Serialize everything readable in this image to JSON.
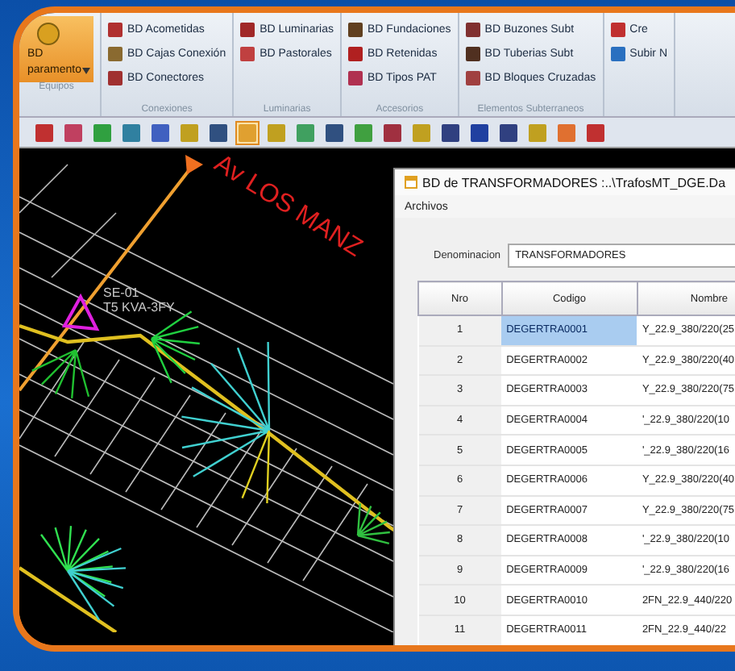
{
  "ribbon": {
    "groups": [
      {
        "label": "Equipos",
        "kind": "large",
        "items": [
          {
            "label": "BD",
            "label2": "paramento",
            "color": "#d9a020"
          }
        ]
      },
      {
        "label": "Conexiones",
        "kind": "small",
        "items": [
          {
            "label": "BD Acometidas",
            "color": "#b03030"
          },
          {
            "label": "BD Cajas Conexión",
            "color": "#8a6a30"
          },
          {
            "label": "BD Conectores",
            "color": "#a03030"
          }
        ]
      },
      {
        "label": "Luminarias",
        "kind": "small",
        "items": [
          {
            "label": "BD Luminarias",
            "color": "#a02828"
          },
          {
            "label": "BD Pastorales",
            "color": "#c04040"
          }
        ]
      },
      {
        "label": "Accesorios",
        "kind": "small",
        "items": [
          {
            "label": "BD Fundaciones",
            "color": "#604020"
          },
          {
            "label": "BD Retenidas",
            "color": "#b02020"
          },
          {
            "label": "BD Tipos PAT",
            "color": "#b03050"
          }
        ]
      },
      {
        "label": "Elementos Subterraneos",
        "kind": "small",
        "items": [
          {
            "label": "BD Buzones Subt",
            "color": "#803030"
          },
          {
            "label": "BD Tuberias Subt",
            "color": "#503020"
          },
          {
            "label": "BD Bloques Cruzadas",
            "color": "#a04040"
          }
        ]
      },
      {
        "kind": "small",
        "items": [
          {
            "label": "Cre",
            "color": "#c03030"
          },
          {
            "label": "Subir N",
            "color": "#2a70c0"
          }
        ]
      }
    ]
  },
  "toolbar": [
    {
      "color": "#c03030",
      "selected": false
    },
    {
      "color": "#c04060",
      "selected": false
    },
    {
      "color": "#30a040",
      "selected": false
    },
    {
      "color": "#3080a0",
      "selected": false
    },
    {
      "color": "#4060c0",
      "selected": false
    },
    {
      "color": "#c0a020",
      "selected": false
    },
    {
      "color": "#305080",
      "selected": false
    },
    {
      "color": "#e0a030",
      "selected": true
    },
    {
      "color": "#c0a020",
      "selected": false
    },
    {
      "color": "#40a060",
      "selected": false
    },
    {
      "color": "#305080",
      "selected": false
    },
    {
      "color": "#40a040",
      "selected": false
    },
    {
      "color": "#a03040",
      "selected": false
    },
    {
      "color": "#c0a020",
      "selected": false
    },
    {
      "color": "#304080",
      "selected": false
    },
    {
      "color": "#2040a0",
      "selected": false
    },
    {
      "color": "#304080",
      "selected": false
    },
    {
      "color": "#c0a020",
      "selected": false
    },
    {
      "color": "#e07030",
      "selected": false
    },
    {
      "color": "#c03030",
      "selected": false
    }
  ],
  "map": {
    "street_label": "Av LOS MANZ",
    "node_label": "SE-01",
    "node_label2": "T5 KVA-3FY"
  },
  "dialog": {
    "title": "BD de TRANSFORMADORES :..\\TrafosMT_DGE.Da",
    "menu": [
      "Archivos"
    ],
    "denominacion_label": "Denominacion",
    "denominacion_value": "TRANSFORMADORES",
    "table": {
      "columns": [
        "Nro",
        "Codigo",
        "Nombre"
      ],
      "rows": [
        {
          "cells": [
            "1",
            "DEGERTRA0001",
            "Y_22.9_380/220(25"
          ],
          "selected": true
        },
        {
          "cells": [
            "2",
            "DEGERTRA0002",
            "Y_22.9_380/220(40"
          ],
          "selected": false
        },
        {
          "cells": [
            "3",
            "DEGERTRA0003",
            "Y_22.9_380/220(75"
          ],
          "selected": false
        },
        {
          "cells": [
            "4",
            "DEGERTRA0004",
            "'_22.9_380/220(10"
          ],
          "selected": false
        },
        {
          "cells": [
            "5",
            "DEGERTRA0005",
            "'_22.9_380/220(16"
          ],
          "selected": false
        },
        {
          "cells": [
            "6",
            "DEGERTRA0006",
            "Y_22.9_380/220(40"
          ],
          "selected": false
        },
        {
          "cells": [
            "7",
            "DEGERTRA0007",
            "Y_22.9_380/220(75"
          ],
          "selected": false
        },
        {
          "cells": [
            "8",
            "DEGERTRA0008",
            "'_22.9_380/220(10"
          ],
          "selected": false
        },
        {
          "cells": [
            "9",
            "DEGERTRA0009",
            "'_22.9_380/220(16"
          ],
          "selected": false
        },
        {
          "cells": [
            "10",
            "DEGERTRA0010",
            "2FN_22.9_440/220"
          ],
          "selected": false
        },
        {
          "cells": [
            "11",
            "DEGERTRA0011",
            "2FN_22.9_440/22"
          ],
          "selected": false
        }
      ]
    }
  }
}
